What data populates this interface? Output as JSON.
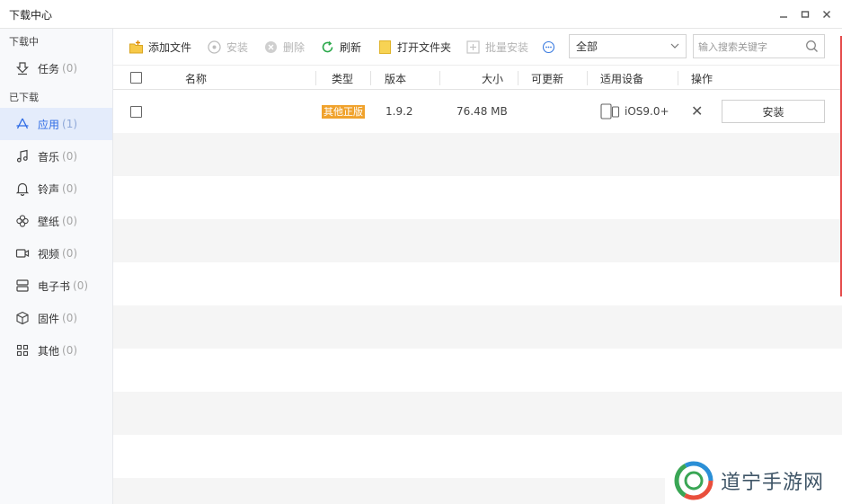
{
  "window": {
    "title": "下载中心",
    "controls": {
      "minimize": "—",
      "maximize": "□",
      "close": "✕"
    }
  },
  "sidebar": {
    "section_downloading": "下载中",
    "section_downloaded": "已下载",
    "items": [
      {
        "label": "任务",
        "count": "(0)",
        "icon": "download-icon"
      },
      {
        "label": "应用",
        "count": "(1)",
        "icon": "app-store-icon",
        "active": true
      },
      {
        "label": "音乐",
        "count": "(0)",
        "icon": "music-note-icon"
      },
      {
        "label": "铃声",
        "count": "(0)",
        "icon": "bell-icon"
      },
      {
        "label": "壁纸",
        "count": "(0)",
        "icon": "flower-icon"
      },
      {
        "label": "视频",
        "count": "(0)",
        "icon": "video-camera-icon"
      },
      {
        "label": "电子书",
        "count": "(0)",
        "icon": "book-icon"
      },
      {
        "label": "固件",
        "count": "(0)",
        "icon": "cube-icon"
      },
      {
        "label": "其他",
        "count": "(0)",
        "icon": "grid-icon"
      }
    ]
  },
  "toolbar": {
    "add_file": "添加文件",
    "install": "安装",
    "delete": "删除",
    "refresh": "刷新",
    "open_folder": "打开文件夹",
    "batch_install": "批量安装",
    "filter_value": "全部",
    "search_placeholder": "输入搜索关键字"
  },
  "table": {
    "headers": {
      "name": "名称",
      "type": "类型",
      "version": "版本",
      "size": "大小",
      "updatable": "可更新",
      "device": "适用设备",
      "action": "操作"
    },
    "rows": [
      {
        "name": "",
        "type": "其他正版",
        "version": "1.9.2",
        "size": "76.48 MB",
        "updatable": "",
        "device": "iOS9.0+",
        "install_label": "安装",
        "delete_glyph": "✕"
      }
    ]
  },
  "watermark": {
    "text": "道宁手游网"
  },
  "colors": {
    "accent": "#2e6be5",
    "badge": "#f0a22c",
    "sidebar_active": "#e4ecfb"
  }
}
